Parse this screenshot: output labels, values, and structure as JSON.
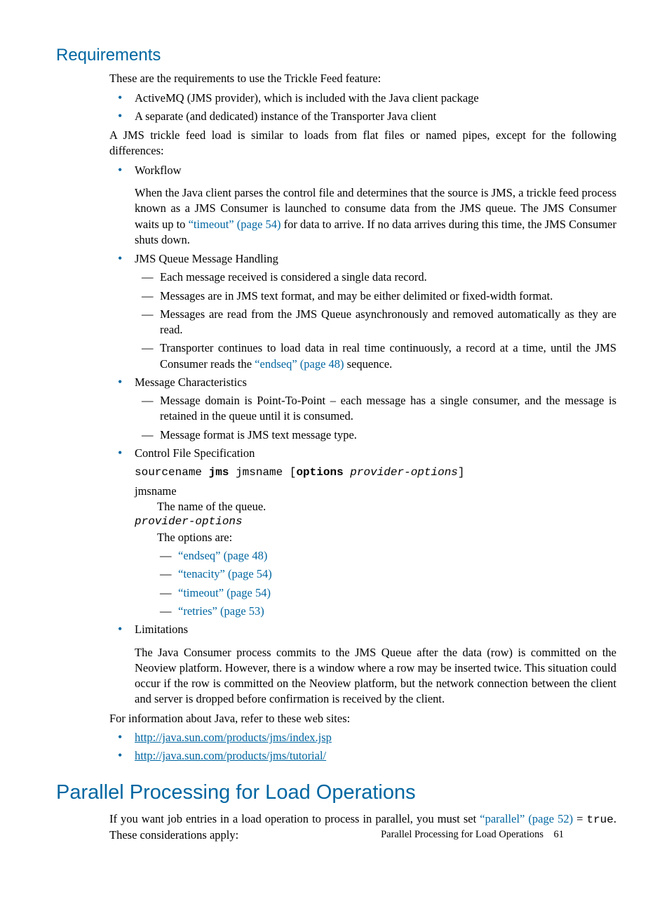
{
  "sec1": {
    "title": "Requirements",
    "p1": "These are the requirements to use the Trickle Feed feature:",
    "reqs": [
      "ActiveMQ (JMS provider), which is included with the Java client package",
      "A separate (and dedicated) instance of the Transporter Java client"
    ],
    "p2": "A JMS trickle feed load is similar to loads from flat files or named pipes, except for the following differences:",
    "workflow": {
      "label": "Workflow",
      "p_a": "When the Java client parses the control file and determines that the source is JMS, a trickle feed process known as a JMS Consumer is launched to consume data from the JMS queue. The JMS Consumer waits up to ",
      "link": "“timeout” (page 54)",
      "p_b": " for data to arrive. If no data arrives during this time, the JMS Consumer shuts down."
    },
    "jmsq": {
      "label": "JMS Queue Message Handling",
      "items": {
        "a": "Each message received is considered a single data record.",
        "b": "Messages are in JMS text format, and may be either delimited or fixed-width format.",
        "c": "Messages are read from the JMS Queue asynchronously and removed automatically as they are read.",
        "d_a": "Transporter continues to load data in real time continuously, a record at a time, until the JMS Consumer reads the ",
        "d_link": "“endseq” (page 48)",
        "d_b": " sequence."
      }
    },
    "msgchar": {
      "label": "Message Characteristics",
      "items": [
        "Message domain is Point-To-Point – each message has a single consumer, and the message is retained in the queue until it is consumed.",
        "Message format is JMS text message type."
      ]
    },
    "ctrlfile": {
      "label": "Control File Specification",
      "code": {
        "a": "sourcename ",
        "b": "jms",
        "c": " jmsname [",
        "d": "options",
        "e": " ",
        "f": "provider-options",
        "g": "]"
      },
      "jmsname_label": "jmsname",
      "jmsname_desc": "The name of the queue.",
      "provopt_label": "provider-options",
      "provopt_desc": "The options are:",
      "opts": [
        "“endseq” (page 48)",
        "“tenacity” (page 54)",
        "“timeout” (page 54)",
        "“retries” (page 53)"
      ]
    },
    "limits": {
      "label": "Limitations",
      "p": "The Java Consumer process commits to the JMS Queue after the data (row) is committed on the Neoview platform. However, there is a window where a row may be inserted twice. This situation could occur if the row is committed on the Neoview platform, but the network connection between the client and server is dropped before confirmation is received by the client."
    },
    "p3": "For information about Java, refer to these web sites:",
    "links": [
      "http://java.sun.com/products/jms/index.jsp",
      "http://java.sun.com/products/jms/tutorial/"
    ]
  },
  "sec2": {
    "title": "Parallel Processing for Load Operations",
    "p_a": "If you want job entries in a load operation to process in parallel, you must set ",
    "link": "“parallel” (page 52)",
    "p_b": " = ",
    "code": "true",
    "p_c": ". These considerations apply:"
  },
  "footer": {
    "text": "Parallel Processing for Load Operations",
    "pagenum": "61"
  }
}
